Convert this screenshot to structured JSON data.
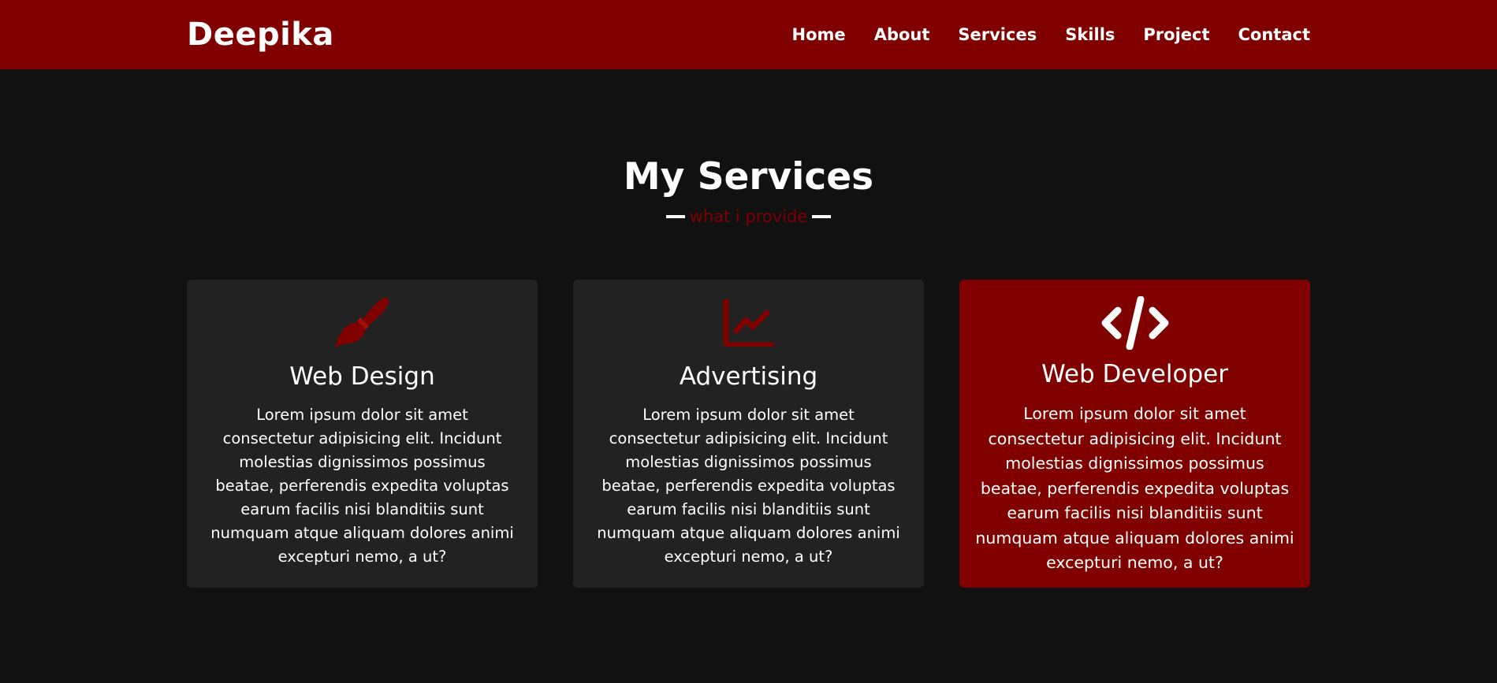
{
  "brand": {
    "name": "Deepika"
  },
  "nav": {
    "items": [
      {
        "label": "Home"
      },
      {
        "label": "About"
      },
      {
        "label": "Services"
      },
      {
        "label": "Skills"
      },
      {
        "label": "Project"
      },
      {
        "label": "Contact"
      }
    ]
  },
  "services": {
    "title": "My Services",
    "subtitle": "what i provide",
    "cards": [
      {
        "icon": "paint-brush-icon",
        "title": "Web Design",
        "description": "Lorem ipsum dolor sit amet consectetur adipisicing elit. Incidunt molestias dignissimos possimus beatae, perferendis expedita voluptas earum facilis nisi blanditiis sunt numquam atque aliquam dolores animi excepturi nemo, a ut?"
      },
      {
        "icon": "chart-line-icon",
        "title": "Advertising",
        "description": "Lorem ipsum dolor sit amet consectetur adipisicing elit. Incidunt molestias dignissimos possimus beatae, perferendis expedita voluptas earum facilis nisi blanditiis sunt numquam atque aliquam dolores animi excepturi nemo, a ut?"
      },
      {
        "icon": "code-icon",
        "title": "Web Developer",
        "description": "Lorem ipsum dolor sit amet consectetur adipisicing elit. Incidunt molestias dignissimos possimus beatae, perferendis expedita voluptas earum facilis nisi blanditiis sunt numquam atque aliquam dolores animi excepturi nemo, a ut?"
      }
    ]
  },
  "colors": {
    "accent": "#800000",
    "background": "#111111",
    "card": "#222222",
    "text": "#ffffff"
  }
}
